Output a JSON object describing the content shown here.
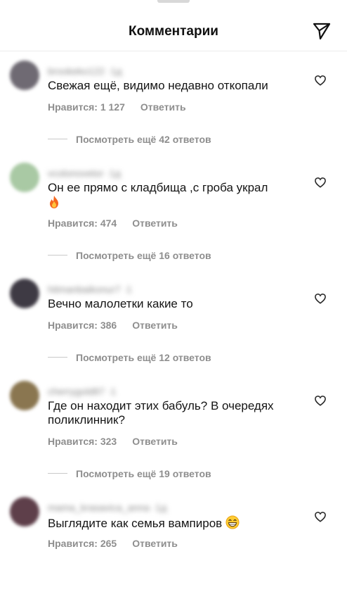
{
  "header": {
    "title": "Комментарии",
    "send_icon": "paper-plane-icon"
  },
  "comments": [
    {
      "username": "brookeko122 ·1д",
      "avatar_color": "#6f6a73",
      "text": "Свежая ещё, видимо недавно откопали",
      "likes": "Нравится: 1 127",
      "reply": "Ответить",
      "view_replies": "Посмотреть ещё 42 ответов"
    },
    {
      "username": "vcolonovetor ·1д",
      "avatar_color": "#a9c9a4",
      "text": "Он ее прямо с кладбища ,с гроба украл",
      "emoji": "fire-emoji",
      "likes": "Нравится: 474",
      "reply": "Ответить",
      "view_replies": "Посмотреть ещё 16 ответов"
    },
    {
      "username": "hitmanbaikonur7 ·1",
      "avatar_color": "#3e3a44",
      "text": "Вечно малолетки какие то",
      "likes": "Нравится: 386",
      "reply": "Ответить",
      "view_replies": "Посмотреть ещё 12 ответов"
    },
    {
      "username": "cherrygold87 ·1",
      "avatar_color": "#8a7650",
      "text": "Где он находит этих бабуль? В очередях поликлинник?",
      "likes": "Нравится: 323",
      "reply": "Ответить",
      "view_replies": "Посмотреть ещё 19 ответов"
    },
    {
      "username": "mama_krasavica_anna ·1д",
      "avatar_color": "#5e3f4a",
      "text": "Выглядите как семья вампиров",
      "emoji": "grinning-face-emoji",
      "likes": "Нравится: 265",
      "reply": "Ответить"
    }
  ]
}
